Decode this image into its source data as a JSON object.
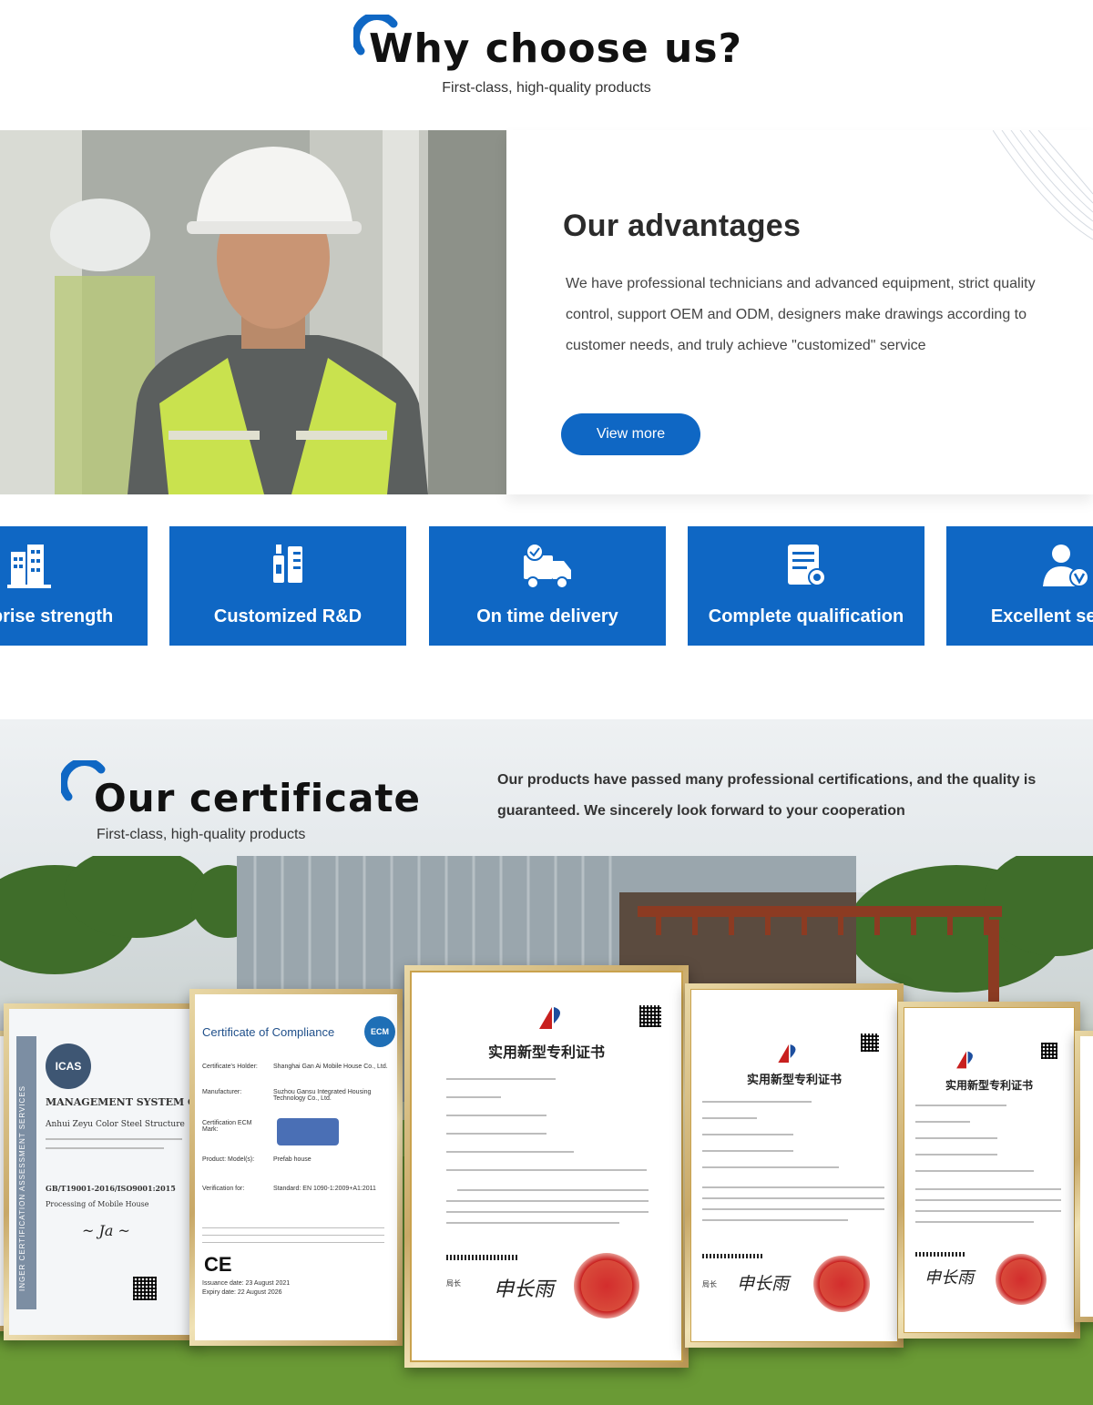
{
  "why": {
    "title": "Why choose us?",
    "subtitle": "First-class, high-quality products"
  },
  "advantages": {
    "title": "Our advantages",
    "text": "We have professional technicians and advanced equipment, strict quality control, support OEM and ODM, designers make drawings according to customer needs, and truly achieve \"customized\" service",
    "button_label": "View more"
  },
  "features": [
    {
      "label": "Enterprise strength",
      "icon": "buildings-icon"
    },
    {
      "label": "Customized R&D",
      "icon": "rd-tools-icon"
    },
    {
      "label": "On time delivery",
      "icon": "delivery-truck-icon"
    },
    {
      "label": "Complete qualification",
      "icon": "certificate-doc-icon"
    },
    {
      "label": "Excellent service",
      "icon": "service-person-icon"
    }
  ],
  "certificate": {
    "title": "Our certificate",
    "subtitle": "First-class, high-quality products",
    "text": "Our products have passed many professional certifications, and the quality is guaranteed. We sincerely look forward to your cooperation",
    "docs": {
      "icas": {
        "badge": "ICAS",
        "heading": "MANAGEMENT SYSTEM CERT",
        "company": "Anhui Zeyu Color Steel Structure",
        "standard": "GB/T19001-2016/ISO9001:2015",
        "scope": "Processing of Mobile House",
        "side": "INGER CERTIFICATION ASSESSMENT SERVICES"
      },
      "ce": {
        "heading": "Certificate of Compliance",
        "badge": "ECM",
        "holder_label": "Certificate's Holder:",
        "holder": "Shanghai Gan Ai Mobile House Co., Ltd.",
        "manufacturer_label": "Manufacturer:",
        "manufacturer": "Suzhou Gansu Integrated Housing Technology Co., Ltd.",
        "mark_label": "Certification ECM Mark:",
        "product_label": "Product: Model(s):",
        "product": "Prefab house",
        "verification_label": "Verification for:",
        "verification": "Standard: EN 1090-1:2009+A1:2011",
        "ce_mark": "CE",
        "issuance": "Issuance date: 23 August 2021",
        "expiry": "Expiry date: 22 August 2026"
      },
      "patent_title": "实用新型专利证书",
      "patent_sig": "申长雨",
      "patent_sig_label": "局长"
    }
  },
  "colors": {
    "brand_blue": "#0f67c4",
    "text_dark": "#2b2b2b",
    "frame_gold": "#c8a867"
  }
}
